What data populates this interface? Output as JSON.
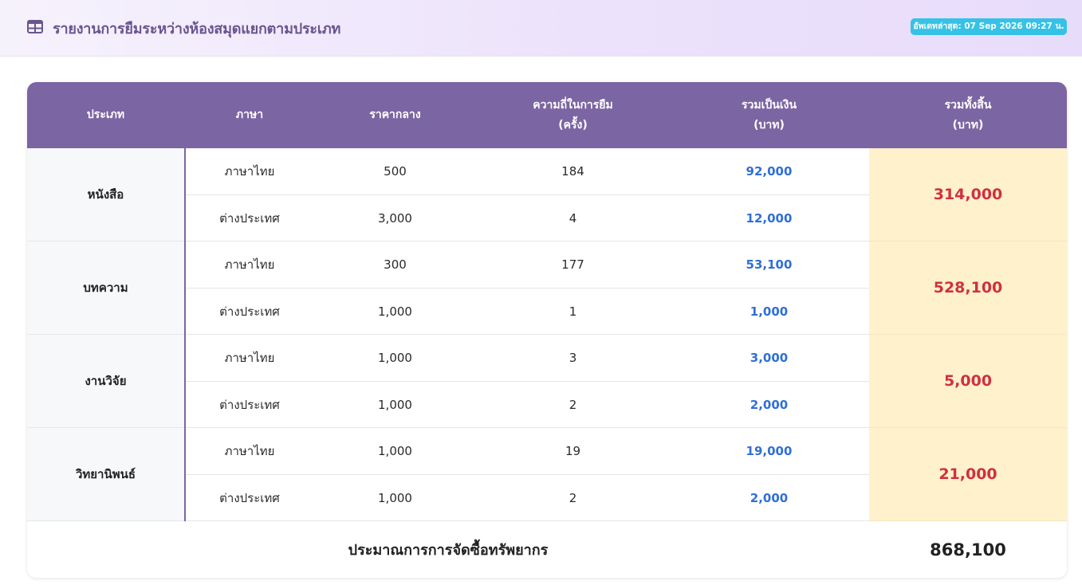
{
  "header": {
    "title": "รายงานการยืมระหว่างห้องสมุดแยกตามประเภท",
    "icon": "table-icon",
    "updated_badge": "อัพเดทล่าสุด: 07 Sep 2026 09:27 น."
  },
  "table": {
    "columns": {
      "type": [
        "ประเภท"
      ],
      "language": [
        "ภาษา"
      ],
      "median_price": [
        "ราคากลาง"
      ],
      "frequency": [
        "ความถี่ในการยืม",
        "(ครั้ง)"
      ],
      "amount": [
        "รวมเป็นเงิน",
        "(บาท)"
      ],
      "grand": [
        "รวมทั้งสิ้น",
        "(บาท)"
      ]
    },
    "groups": [
      {
        "type": "หนังสือ",
        "total": "314,000",
        "rows": [
          {
            "language": "ภาษาไทย",
            "price": "500",
            "freq": "184",
            "amount": "92,000"
          },
          {
            "language": "ต่างประเทศ",
            "price": "3,000",
            "freq": "4",
            "amount": "12,000"
          }
        ]
      },
      {
        "type": "บทความ",
        "total": "528,100",
        "rows": [
          {
            "language": "ภาษาไทย",
            "price": "300",
            "freq": "177",
            "amount": "53,100"
          },
          {
            "language": "ต่างประเทศ",
            "price": "1,000",
            "freq": "1",
            "amount": "1,000"
          }
        ]
      },
      {
        "type": "งานวิจัย",
        "total": "5,000",
        "rows": [
          {
            "language": "ภาษาไทย",
            "price": "1,000",
            "freq": "3",
            "amount": "3,000"
          },
          {
            "language": "ต่างประเทศ",
            "price": "1,000",
            "freq": "2",
            "amount": "2,000"
          }
        ]
      },
      {
        "type": "วิทยานิพนธ์",
        "total": "21,000",
        "rows": [
          {
            "language": "ภาษาไทย",
            "price": "1,000",
            "freq": "19",
            "amount": "19,000"
          },
          {
            "language": "ต่างประเทศ",
            "price": "1,000",
            "freq": "2",
            "amount": "2,000"
          }
        ]
      }
    ],
    "footer": {
      "label": "ประมาณการการจัดซื้อทรัพยากร",
      "value": "868,100"
    }
  },
  "colors": {
    "accent": "#7c65a3",
    "amount": "#2f6fd8",
    "total": "#d03040",
    "total_bg": "#fef1cc",
    "badge": "#35c2e6"
  }
}
